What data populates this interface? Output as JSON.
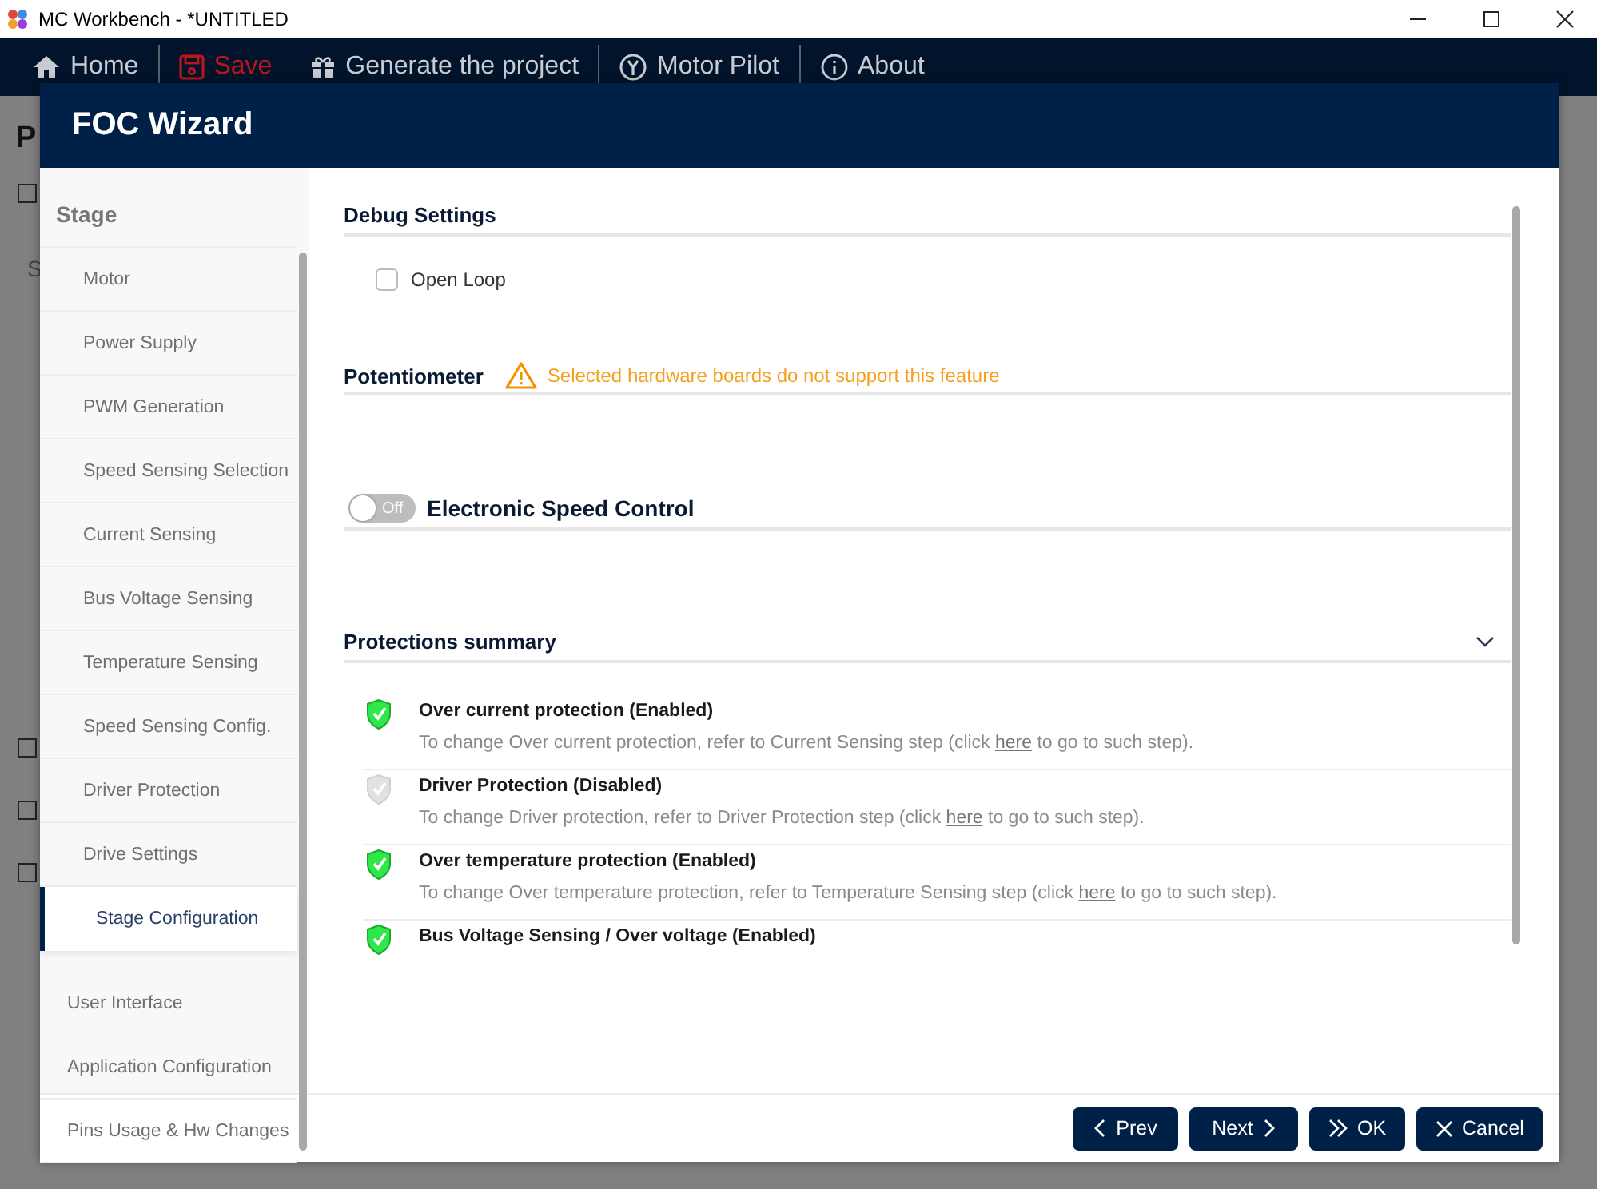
{
  "window": {
    "title": "MC Workbench - *UNTITLED"
  },
  "nav": [
    {
      "label": "Home",
      "kind": "home",
      "modified": false,
      "divider": true
    },
    {
      "label": "Save",
      "kind": "save",
      "modified": true,
      "divider": false
    },
    {
      "label": "Generate the project",
      "kind": "gift",
      "modified": false,
      "divider": true
    },
    {
      "label": "Motor Pilot",
      "kind": "pilot",
      "modified": false,
      "divider": true
    },
    {
      "label": "About",
      "kind": "info",
      "modified": false,
      "divider": false
    }
  ],
  "backdrop": {
    "heading": "P",
    "label": "S",
    "checkboxes": [
      {
        "checked": false
      },
      {
        "checked": false
      },
      {
        "checked": false
      },
      {
        "checked": false
      }
    ]
  },
  "dialog": {
    "title": "FOC Wizard",
    "sidebar": {
      "items": [
        {
          "label": "Stage",
          "kind": "group",
          "children": [
            {
              "label": "Motor",
              "selected": false
            },
            {
              "label": "Power Supply",
              "selected": false
            },
            {
              "label": "PWM Generation",
              "selected": false
            },
            {
              "label": "Speed Sensing Selection",
              "selected": false
            },
            {
              "label": "Current Sensing",
              "selected": false
            },
            {
              "label": "Bus Voltage Sensing",
              "selected": false
            },
            {
              "label": "Temperature Sensing",
              "selected": false
            },
            {
              "label": "Speed Sensing Config.",
              "selected": false
            },
            {
              "label": "Driver Protection",
              "selected": false
            },
            {
              "label": "Drive Settings",
              "selected": false
            },
            {
              "label": "Stage Configuration",
              "selected": true
            }
          ]
        },
        {
          "label": "User Interface",
          "kind": "item",
          "selected": false
        },
        {
          "label": "Application Configuration",
          "kind": "item",
          "selected": false
        },
        {
          "label": "Pins Usage & Hw Changes",
          "kind": "item",
          "selected": false
        }
      ]
    },
    "debug_settings": {
      "title": "Debug Settings",
      "options": [
        {
          "label": "Open Loop",
          "checked": false
        }
      ]
    },
    "potentiometer": {
      "title": "Potentiometer",
      "warning": "Selected hardware boards do not support this feature"
    },
    "speed_control": {
      "title": "Electronic Speed Control",
      "on": false,
      "switch_label": "Off"
    },
    "protections": {
      "title": "Protections summary",
      "expanded": true,
      "items": [
        {
          "title": "Over current protection (Enabled)",
          "enabled": true,
          "text_before": "To change Over current protection, refer to Current Sensing step (click",
          "link": "here",
          "text_after": "to go to such step)."
        },
        {
          "title": "Driver Protection (Disabled)",
          "enabled": false,
          "text_before": "To change Driver protection, refer to Driver Protection step (click",
          "link": "here",
          "text_after": "to go to such step)."
        },
        {
          "title": "Over temperature protection (Enabled)",
          "enabled": true,
          "text_before": "To change Over temperature protection, refer to Temperature Sensing step (click",
          "link": "here",
          "text_after": "to go to such step)."
        },
        {
          "title": "Bus Voltage Sensing / Over voltage (Enabled)",
          "enabled": true
        }
      ]
    },
    "buttons": [
      {
        "label": "Prev",
        "kind": "prev"
      },
      {
        "label": "Next",
        "kind": "next"
      },
      {
        "label": "OK",
        "kind": "ok"
      },
      {
        "label": "Cancel",
        "kind": "cancel"
      }
    ]
  }
}
